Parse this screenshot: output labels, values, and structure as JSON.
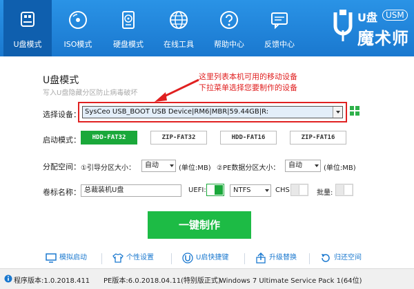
{
  "nav": [
    {
      "label": "U盘模式",
      "icon": "usb-drive-icon",
      "active": true
    },
    {
      "label": "ISO模式",
      "icon": "disc-icon",
      "active": false
    },
    {
      "label": "硬盘模式",
      "icon": "hard-disk-icon",
      "active": false
    },
    {
      "label": "在线工具",
      "icon": "globe-icon",
      "active": false
    },
    {
      "label": "帮助中心",
      "icon": "help-icon",
      "active": false
    },
    {
      "label": "反馈中心",
      "icon": "feedback-icon",
      "active": false
    }
  ],
  "brand": {
    "u": "U盘",
    "usm": "USM",
    "name": "魔术师"
  },
  "mode": {
    "title": "U盘模式",
    "subtitle": "写入U盘隐藏分区防止病毒破坏"
  },
  "annotation": {
    "line1": "这里列表本机可用的移动设备",
    "line2": "下拉菜单选择您要制作的设备"
  },
  "device": {
    "label": "选择设备：",
    "value": "SysCeo USB_BOOT USB Device|RM6|MBR|59.44GB|R:"
  },
  "boot": {
    "label": "启动模式：",
    "options": [
      "HDD-FAT32",
      "ZIP-FAT32",
      "HDD-FAT16",
      "ZIP-FAT16"
    ],
    "selected": 0
  },
  "partition": {
    "label": "分配空间：",
    "boot_label": "①引导分区大小：",
    "boot_value": "自动",
    "boot_unit": "(单位:MB)",
    "pe_label": "②PE数据分区大小：",
    "pe_value": "自动",
    "pe_unit": "(单位:MB)"
  },
  "volume": {
    "label": "卷标名称：",
    "value": "总裁装机U盘",
    "uefi_label": "UEFI:",
    "fs_value": "NTFS",
    "chs_label": "CHS:",
    "batch_label": "批量:"
  },
  "action": {
    "make_label": "一键制作"
  },
  "tools": [
    {
      "label": "模拟启动",
      "icon": "monitor-icon"
    },
    {
      "label": "个性设置",
      "icon": "shirt-icon"
    },
    {
      "label": "U启快捷键",
      "icon": "u-shortcut-icon"
    },
    {
      "label": "升级替换",
      "icon": "upgrade-icon"
    },
    {
      "label": "归还空间",
      "icon": "restore-icon"
    }
  ],
  "status": {
    "program": "程序版本:1.0.2018.411",
    "pe": "PE版本:6.0.2018.04.11",
    "edition": "(特别版正式)",
    "os": "Windows 7 Ultimate Service Pack 1(64位)"
  },
  "colors": {
    "nav_bg": "#1a78cf",
    "nav_active": "#0f5fae",
    "accent_green": "#1dbb45",
    "annotation_red": "#e02020"
  }
}
